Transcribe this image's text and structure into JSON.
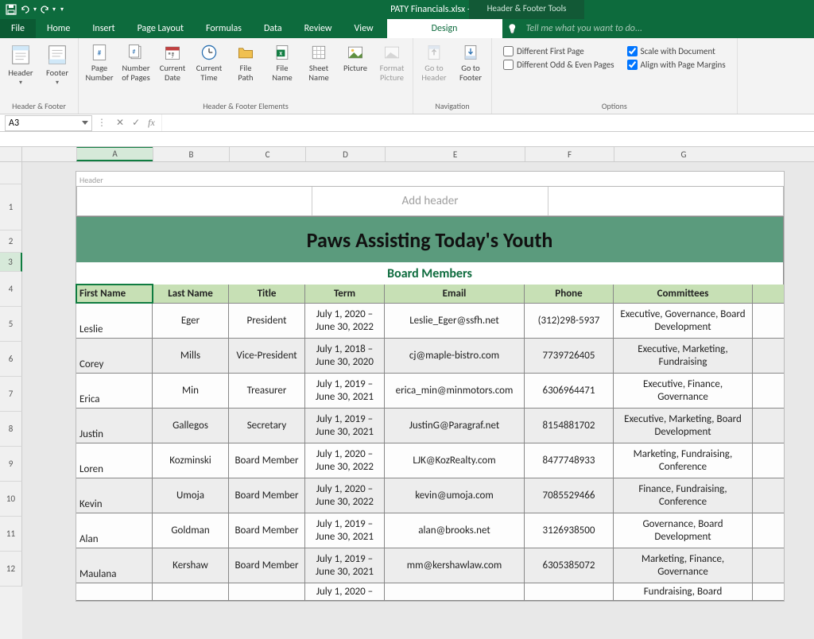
{
  "qat": {
    "save": "💾",
    "undo": "↶",
    "redo": "↷"
  },
  "title": "PATY Financials.xlsx - Excel",
  "contextTab": "Header & Footer Tools",
  "tabs": {
    "file": "File",
    "home": "Home",
    "insert": "Insert",
    "pageLayout": "Page Layout",
    "formulas": "Formulas",
    "data": "Data",
    "review": "Review",
    "view": "View",
    "design": "Design"
  },
  "tellMe": "Tell me what you want to do...",
  "ribbon": {
    "hf": {
      "header": "Header",
      "footer": "Footer",
      "label": "Header & Footer"
    },
    "elements": {
      "pageNumber": "Page Number",
      "numPages": "Number of Pages",
      "curDate": "Current Date",
      "curTime": "Current Time",
      "filePath": "File Path",
      "fileName": "File Name",
      "sheetName": "Sheet Name",
      "picture": "Picture",
      "formatPicture": "Format Picture",
      "label": "Header & Footer Elements"
    },
    "nav": {
      "goToHeader": "Go to Header",
      "goToFooter": "Go to Footer",
      "label": "Navigation"
    },
    "options": {
      "diffFirst": "Different First Page",
      "diffOddEven": "Different Odd & Even Pages",
      "scaleWithDoc": "Scale with Document",
      "alignMargins": "Align with Page Margins",
      "label": "Options"
    }
  },
  "namebox": "A3",
  "headerRegionLabel": "Header",
  "addHeader": "Add header",
  "columns": [
    "A",
    "B",
    "C",
    "D",
    "E",
    "F",
    "G"
  ],
  "rowNums": [
    "1",
    "2",
    "3",
    "4",
    "5",
    "6",
    "7",
    "8",
    "9",
    "10",
    "11",
    "12"
  ],
  "sheet": {
    "orgTitle": "Paws Assisting Today's Youth",
    "subtitle": "Board Members",
    "headers": [
      "First Name",
      "Last Name",
      "Title",
      "Term",
      "Email",
      "Phone",
      "Committees"
    ],
    "rows": [
      {
        "first": "Leslie",
        "last": "Eger",
        "title": "President",
        "term": "July 1, 2020 – June 30, 2022",
        "email": "Leslie_Eger@ssfh.net",
        "phone": "(312)298-5937",
        "committees": "Executive, Governance, Board Development"
      },
      {
        "first": "Corey",
        "last": "Mills",
        "title": "Vice-President",
        "term": "July 1, 2018 – June 30, 2020",
        "email": "cj@maple-bistro.com",
        "phone": "7739726405",
        "committees": "Executive, Marketing, Fundraising"
      },
      {
        "first": "Erica",
        "last": "Min",
        "title": "Treasurer",
        "term": "July 1, 2019 – June 30, 2021",
        "email": "erica_min@minmotors.com",
        "phone": "6306964471",
        "committees": "Executive, Finance, Governance"
      },
      {
        "first": "Justin",
        "last": "Gallegos",
        "title": "Secretary",
        "term": "July 1, 2019 – June 30, 2021",
        "email": "JustinG@Paragraf.net",
        "phone": "8154881702",
        "committees": "Executive, Marketing, Board Development"
      },
      {
        "first": "Loren",
        "last": "Kozminski",
        "title": "Board Member",
        "term": "July 1, 2020 – June 30, 2022",
        "email": "LJK@KozRealty.com",
        "phone": "8477748933",
        "committees": "Marketing, Fundraising, Conference"
      },
      {
        "first": "Kevin",
        "last": "Umoja",
        "title": "Board Member",
        "term": "July 1, 2020 – June 30, 2022",
        "email": "kevin@umoja.com",
        "phone": "7085529466",
        "committees": "Finance, Fundraising, Conference"
      },
      {
        "first": "Alan",
        "last": "Goldman",
        "title": "Board Member",
        "term": "July 1, 2019 – June 30, 2021",
        "email": "alan@brooks.net",
        "phone": "3126938500",
        "committees": "Governance, Board Development"
      },
      {
        "first": "Maulana",
        "last": "Kershaw",
        "title": "Board Member",
        "term": "July 1, 2019 – June 30, 2021",
        "email": "mm@kershawlaw.com",
        "phone": "6305385072",
        "committees": "Marketing, Finance, Governance"
      },
      {
        "first": "",
        "last": "",
        "title": "",
        "term": "July 1, 2020 –",
        "email": "",
        "phone": "",
        "committees": "Fundraising, Board"
      }
    ]
  }
}
